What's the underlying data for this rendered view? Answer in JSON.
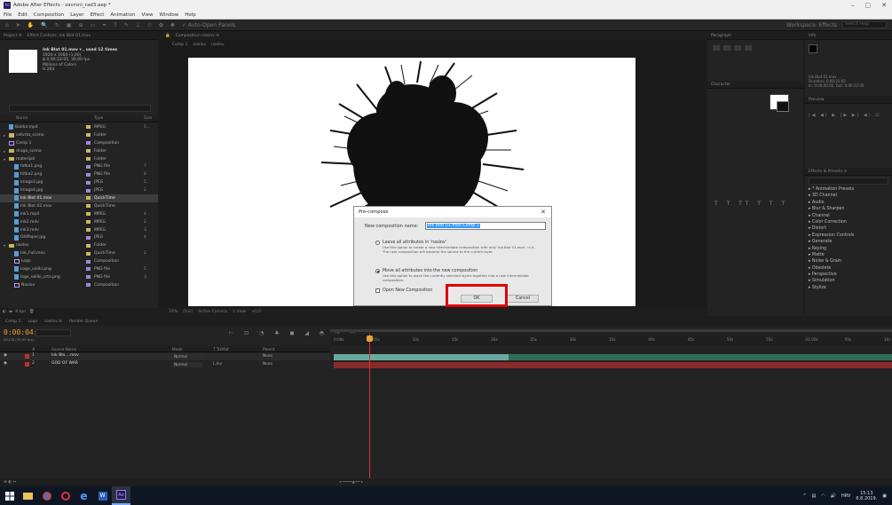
{
  "window": {
    "title": "Adobe After Effects - zavrsni_rad3.aep *",
    "app_icon": "Ae"
  },
  "menu": [
    "File",
    "Edit",
    "Composition",
    "Layer",
    "Effect",
    "Animation",
    "View",
    "Window",
    "Help"
  ],
  "toolbar": {
    "snap_label": "✓ Auto-Open Panels",
    "workspace": "Workspace: Effects",
    "search_placeholder": "Search Help"
  },
  "project": {
    "tabs": [
      "Project ≡",
      "Effect Controls: Ink Blot 01.mov"
    ],
    "selected_name": "Ink Blot 01.mov ▾ , used 12 times",
    "info_lines": [
      "1920 x 1080 (1,00)",
      "Δ 0:00:22:05, 30,00 fps",
      "Millions of Colors",
      "H.264"
    ],
    "columns": [
      "Name",
      "Type",
      "Size"
    ],
    "items": [
      {
        "name": "Baldur.mp4",
        "type": "MPEG",
        "icon": "file",
        "size": "1,..",
        "indent": 0,
        "twirl": ""
      },
      {
        "name": "cetvrta_scena",
        "type": "Folder",
        "icon": "folder",
        "size": "",
        "indent": 0,
        "twirl": "▸"
      },
      {
        "name": "Comp 1",
        "type": "Composition",
        "icon": "comp",
        "size": "",
        "indent": 0,
        "twirl": ""
      },
      {
        "name": "druga_scena",
        "type": "Folder",
        "icon": "folder",
        "size": "",
        "indent": 0,
        "twirl": "▸"
      },
      {
        "name": "materijali",
        "type": "Folder",
        "icon": "folder",
        "size": "",
        "indent": 0,
        "twirl": "▾"
      },
      {
        "name": "fotka1.png",
        "type": "PNG file",
        "icon": "file",
        "size": "7",
        "indent": 1,
        "twirl": ""
      },
      {
        "name": "fotka2.png",
        "type": "PNG file",
        "icon": "file",
        "size": "8",
        "indent": 1,
        "twirl": ""
      },
      {
        "name": "image3.jpg",
        "type": "JPEG",
        "icon": "file",
        "size": "5",
        "indent": 1,
        "twirl": ""
      },
      {
        "name": "image4.jpg",
        "type": "JPEG",
        "icon": "file",
        "size": "2",
        "indent": 1,
        "twirl": ""
      },
      {
        "name": "Ink Blot 01.mov",
        "type": "QuickTime",
        "icon": "file",
        "size": "",
        "indent": 1,
        "twirl": "",
        "selected": true
      },
      {
        "name": "Ink Blot 02.mov",
        "type": "QuickTime",
        "icon": "file",
        "size": "",
        "indent": 1,
        "twirl": ""
      },
      {
        "name": "ink1.mp4",
        "type": "MPEG",
        "icon": "file",
        "size": "4",
        "indent": 1,
        "twirl": ""
      },
      {
        "name": "ink2.m4v",
        "type": "MPEG",
        "icon": "file",
        "size": "2",
        "indent": 1,
        "twirl": ""
      },
      {
        "name": "ink3.m4v",
        "type": "MPEG",
        "icon": "file",
        "size": "3",
        "indent": 1,
        "twirl": ""
      },
      {
        "name": "OldPaper.jpg",
        "type": "JPEG",
        "icon": "file",
        "size": "4",
        "indent": 1,
        "twirl": ""
      },
      {
        "name": "naslov",
        "type": "Folder",
        "icon": "folder",
        "size": "",
        "indent": 0,
        "twirl": "▾"
      },
      {
        "name": "Ink_Full.mov",
        "type": "QuickTime",
        "icon": "file",
        "size": "2",
        "indent": 1,
        "twirl": ""
      },
      {
        "name": "Logo",
        "type": "Composition",
        "icon": "comp",
        "size": "",
        "indent": 1,
        "twirl": ""
      },
      {
        "name": "Logo_veliki.png",
        "type": "PNG file",
        "icon": "file",
        "size": "5",
        "indent": 1,
        "twirl": ""
      },
      {
        "name": "logo_veliki_crta.png",
        "type": "PNG file",
        "icon": "file",
        "size": "3",
        "indent": 1,
        "twirl": ""
      },
      {
        "name": "Naslov",
        "type": "Composition",
        "icon": "comp",
        "size": "",
        "indent": 1,
        "twirl": ""
      }
    ],
    "footer": "8 bpc"
  },
  "viewer": {
    "tab": "Composition naslov ≡",
    "crumbs": [
      "Comp 1",
      "naslov",
      "naslov"
    ],
    "footer": [
      "33%",
      "(Full)",
      "Active Camera",
      "1 View",
      "+0,0"
    ]
  },
  "right": {
    "paragraph_tab": "Paragraph",
    "info_tab": "Info",
    "character_tab": "Character",
    "preview_tab": "Preview",
    "effects_tab": "Effects & Presets ≡",
    "info_lines": [
      "Ink Blot 01.mov",
      "Duration: 0:00:22:05",
      "In: 0:00:00:00, Out: 0:00:22:05"
    ],
    "effects": [
      "▸ * Animation Presets",
      "▸ 3D Channel",
      "▸ Audio",
      "▸ Blur & Sharpen",
      "▸ Channel",
      "▸ Color Correction",
      "▸ Distort",
      "▸ Expression Controls",
      "▸ Generate",
      "▸ Keying",
      "▸ Matte",
      "▸ Noise & Grain",
      "▸ Obsolete",
      "▸ Perspective",
      "▸ Simulation",
      "▸ Stylize"
    ]
  },
  "dialog": {
    "title": "Pre-compose",
    "name_label": "New composition name:",
    "name_value": "Ink Blot 01.mov Comp 1",
    "option1": "Leave all attributes in 'naslov'",
    "option1_desc": "Use this option to create a new intermediate composition with only 'Ink Blot 01.mov', in it. The new composition will become the source to the current layer.",
    "option2": "Move all attributes into the new composition",
    "option2_desc": "Use this option to place the currently selected layers together into a new intermediate composition.",
    "open_new": "Open New Composition",
    "ok": "OK",
    "cancel": "Cancel"
  },
  "timeline": {
    "tabs": [
      "Comp 1",
      "Logo",
      "naslov ≡",
      "Render Queue"
    ],
    "timecode": "0:00:04:08",
    "fps": "00128 (30.00 fps)",
    "columns": [
      "#",
      "Source Name",
      "Mode",
      "T TrkMat",
      "Parent"
    ],
    "layers": [
      {
        "index": "1",
        "name": "Ink Blo....mov",
        "mode": "Normal",
        "trkmat": "",
        "parent": "None"
      },
      {
        "index": "2",
        "name": "GOD OF WAR",
        "mode": "Normal",
        "trkmat": "L.Inv",
        "parent": "None"
      }
    ],
    "ruler": [
      "0:00s",
      "05s",
      "10s",
      "15s",
      "20s",
      "25s",
      "30s",
      "35s",
      "40s",
      "45s",
      "50s",
      "55s",
      "01:00s",
      "05s",
      "10s"
    ]
  },
  "taskbar": {
    "clock_time": "15:13",
    "clock_date": "6.8.2019.",
    "lang": "HRV"
  }
}
